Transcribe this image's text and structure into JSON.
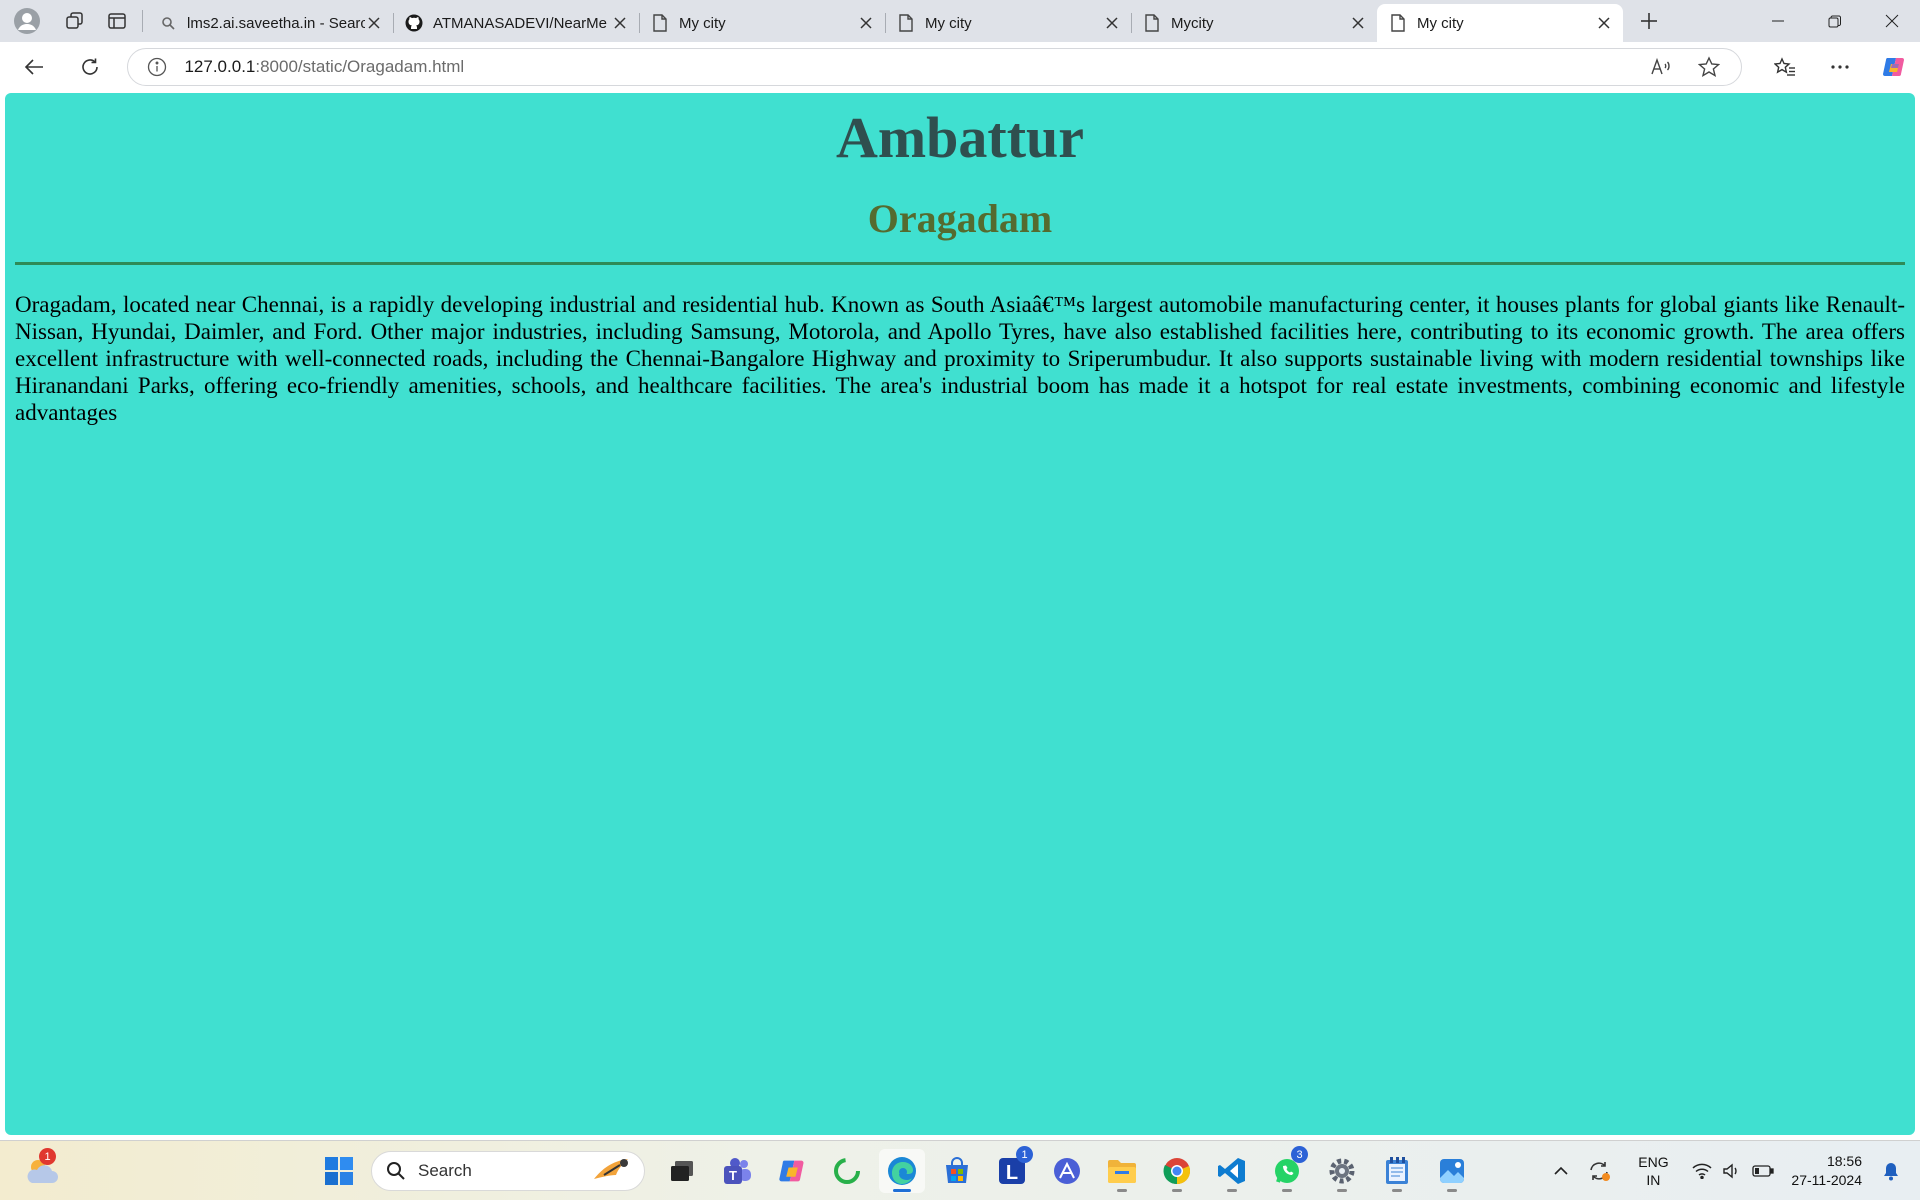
{
  "browser": {
    "tabs": [
      {
        "title": "lms2.ai.saveetha.in - Search",
        "favicon": "search-icon",
        "active": false
      },
      {
        "title": "ATMANASADEVI/NearMe",
        "favicon": "github-icon",
        "active": false
      },
      {
        "title": "My city",
        "favicon": "page-icon",
        "active": false
      },
      {
        "title": "My city",
        "favicon": "page-icon",
        "active": false
      },
      {
        "title": "Mycity",
        "favicon": "page-icon",
        "active": false
      },
      {
        "title": "My city",
        "favicon": "page-icon",
        "active": true
      }
    ],
    "url_host": "127.0.0.1",
    "url_rest": ":8000/static/Oragadam.html"
  },
  "page": {
    "title": "Ambattur",
    "subtitle": "Oragadam",
    "paragraph": "Oragadam, located near Chennai, is a rapidly developing industrial and residential hub. Known as South Asiaâ€™s largest automobile manufacturing center, it houses plants for global giants like Renault-Nissan, Hyundai, Daimler, and Ford. Other major industries, including Samsung, Motorola, and Apollo Tyres, have also established facilities here, contributing to its economic growth. The area offers excellent infrastructure with well-connected roads, including the Chennai-Bangalore Highway and proximity to Sriperumbudur. It also supports sustainable living with modern residential townships like Hiranandani Parks, offering eco-friendly amenities, schools, and healthcare facilities. The area's industrial boom has made it a hotspot for real estate investments, combining economic and lifestyle advantages",
    "colors": {
      "background": "#40e0d0",
      "title": "#2f4f4f",
      "subtitle": "#556b2f",
      "rule": "#2e8b57"
    }
  },
  "taskbar": {
    "weather_badge": "1",
    "search_label": "Search",
    "apps": [
      "windows-start-icon",
      "task-view-icon",
      "teams-icon",
      "copilot-icon",
      "loop-icon",
      "edge-icon",
      "store-icon",
      "lens-app-icon",
      "vector-app-icon",
      "file-explorer-icon",
      "chrome-icon",
      "vscode-icon",
      "whatsapp-icon",
      "settings-icon",
      "notepad-icon",
      "photos-icon"
    ],
    "lens_badge": "1",
    "whatsapp_badge": "3",
    "lang_line1": "ENG",
    "lang_line2": "IN",
    "time": "18:56",
    "date": "27-11-2024"
  }
}
